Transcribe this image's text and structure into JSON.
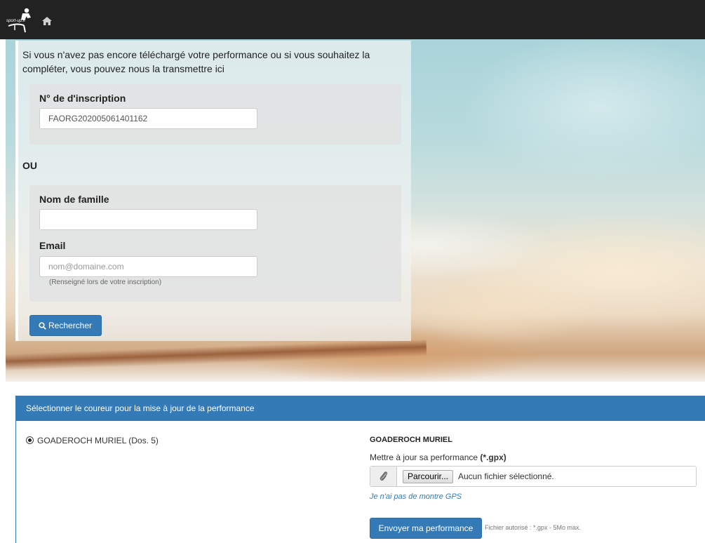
{
  "navbar": {
    "logo_alt": "sport-up.fr",
    "home_icon": "home-icon"
  },
  "form": {
    "intro": "Si vous n'avez pas encore téléchargé votre performance ou si vous souhaitez la compléter, vous pouvez nous la transmettre ici",
    "inscription_label": "N° de d'inscription",
    "inscription_value": "FAORG202005061401162",
    "or_label": "OU",
    "lastname_label": "Nom de famille",
    "lastname_value": "",
    "email_label": "Email",
    "email_placeholder": "nom@domaine.com",
    "email_hint": "(Renseigné lors de votre inscription)",
    "search_button": "Rechercher",
    "search_icon": "search-icon"
  },
  "runner_card": {
    "header": "Sélectionner le coureur pour la mise à jour de la performance",
    "runner_option": "GOADEROCH MURIEL (Dos. 5)",
    "runner_selected": true,
    "selected_name": "GOADEROCH MURIEL",
    "update_label_prefix": "Mettre à jour sa performance ",
    "update_label_ext": "(*.gpx)",
    "file_icon": "paperclip-icon",
    "browse_button": "Parcourir...",
    "no_file_text": "Aucun fichier sélectionné.",
    "no_gps_link": "Je n'ai pas de montre GPS",
    "send_button": "Envoyer ma performance",
    "allowed_text": "Fichier autorisé : *.gpx - 5Mo max."
  },
  "colors": {
    "navbar": "#222222",
    "primary": "#337ab7"
  }
}
